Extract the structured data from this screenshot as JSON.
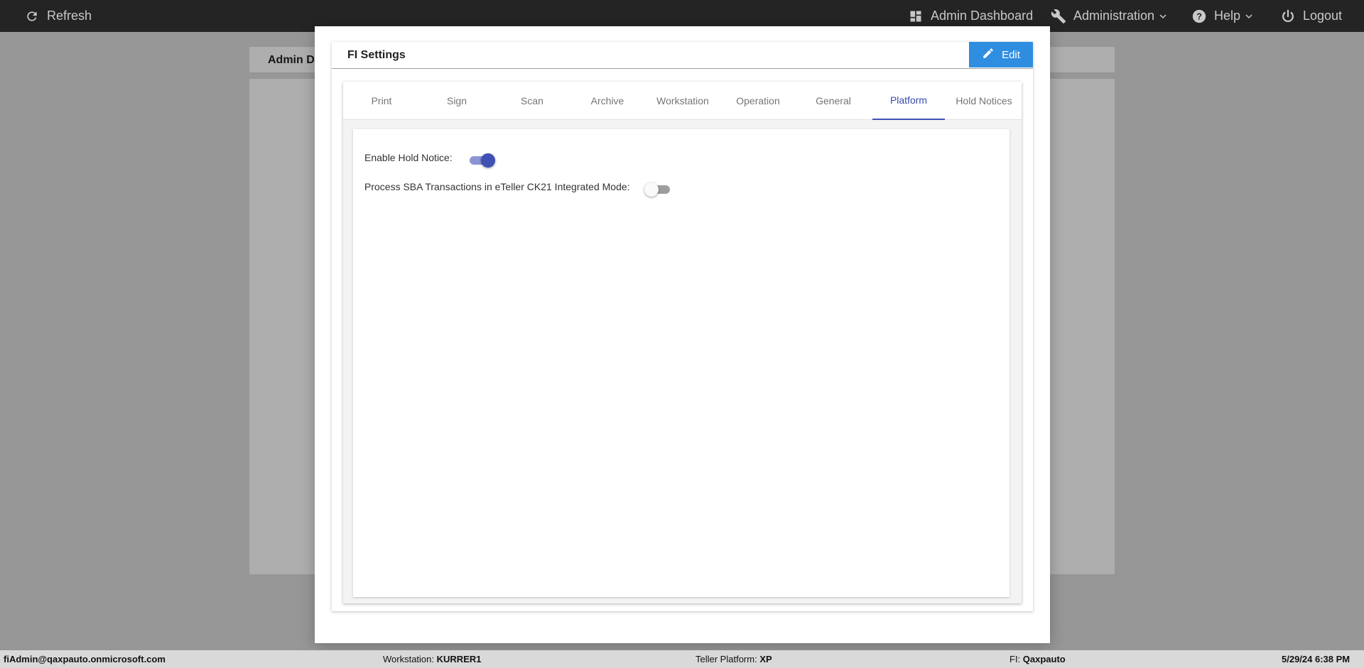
{
  "topbar": {
    "refresh_label": "Refresh",
    "admin_dashboard_label": "Admin Dashboard",
    "administration_label": "Administration",
    "help_label": "Help",
    "logout_label": "Logout"
  },
  "background": {
    "title": "Admin D"
  },
  "modal": {
    "title": "FI Settings",
    "edit_label": "Edit",
    "tabs": [
      {
        "label": "Print"
      },
      {
        "label": "Sign"
      },
      {
        "label": "Scan"
      },
      {
        "label": "Archive"
      },
      {
        "label": "Workstation"
      },
      {
        "label": "Operation"
      },
      {
        "label": "General"
      },
      {
        "label": "Platform"
      },
      {
        "label": "Hold Notices"
      }
    ],
    "active_tab": "Platform",
    "settings": [
      {
        "label": "Enable Hold Notice:",
        "enabled": true
      },
      {
        "label": "Process SBA Transactions in eTeller CK21 Integrated Mode:",
        "enabled": false
      }
    ]
  },
  "statusbar": {
    "user": "fiAdmin@qaxpauto.onmicrosoft.com",
    "workstation_label": "Workstation:",
    "workstation_value": "KURRER1",
    "platform_label": "Teller Platform:",
    "platform_value": "XP",
    "fi_label": "FI:",
    "fi_value": "Qaxpauto",
    "datetime": "5/29/24 6:38 PM"
  },
  "colors": {
    "topbar_bg": "#242424",
    "accent": "#3f51b5",
    "edit_button": "#2f8ee0"
  }
}
